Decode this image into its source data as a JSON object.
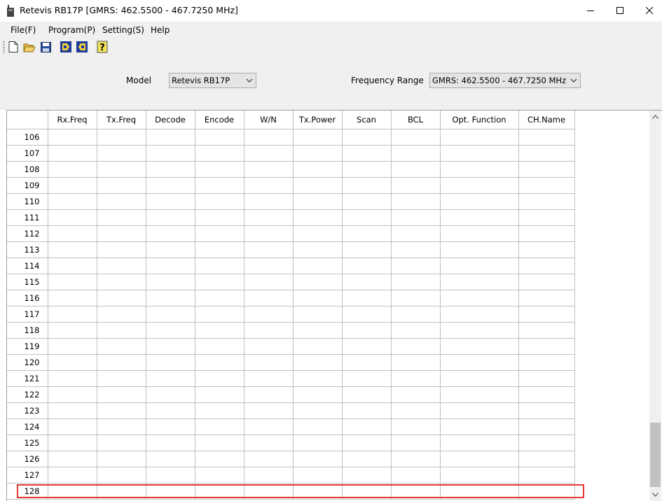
{
  "window": {
    "title": "Retevis RB17P [GMRS:  462.5500 -  467.7250 MHz]",
    "controls": [
      "minimize-icon",
      "maximize-icon",
      "close-icon"
    ]
  },
  "menu": {
    "items": [
      {
        "label": "File(F)"
      },
      {
        "label": "Program(P)"
      },
      {
        "label": "Setting(S)"
      },
      {
        "label": "Help"
      }
    ]
  },
  "toolbar": {
    "buttons": [
      "new-file-icon",
      "open-folder-icon",
      "save-disk-icon",
      "read-radio-icon",
      "write-radio-icon",
      "help-question-icon"
    ]
  },
  "settings": {
    "model_label": "Model",
    "model_value": "Retevis RB17P",
    "freq_label": "Frequency Range",
    "freq_value": "GMRS:  462.5500 -  467.7250 MHz"
  },
  "grid": {
    "columns": [
      "Rx.Freq",
      "Tx.Freq",
      "Decode",
      "Encode",
      "W/N",
      "Tx.Power",
      "Scan",
      "BCL",
      "Opt. Function",
      "CH.Name"
    ],
    "rows": [
      "106",
      "107",
      "108",
      "109",
      "110",
      "111",
      "112",
      "113",
      "114",
      "115",
      "116",
      "117",
      "118",
      "119",
      "120",
      "121",
      "122",
      "123",
      "124",
      "125",
      "126",
      "127",
      "128"
    ]
  },
  "colors": {
    "highlight": "#e53935",
    "chrome": "#f0f0f0",
    "gridline": "#c0c0c0"
  }
}
